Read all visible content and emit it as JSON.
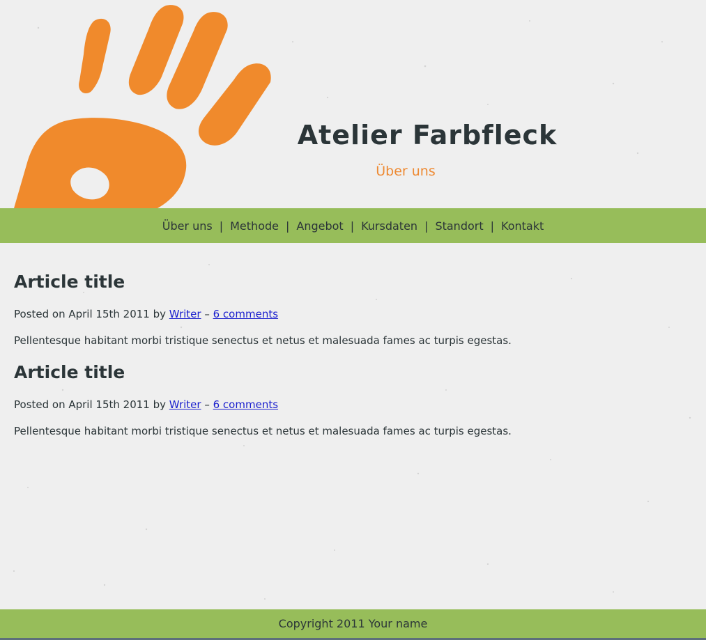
{
  "header": {
    "site_title": "Atelier Farbfleck",
    "subtitle": "Über uns"
  },
  "nav": {
    "items": [
      {
        "label": "Über uns"
      },
      {
        "label": "Methode"
      },
      {
        "label": "Angebot"
      },
      {
        "label": "Kursdaten"
      },
      {
        "label": "Standort"
      },
      {
        "label": "Kontakt"
      }
    ],
    "separator": "|"
  },
  "articles": [
    {
      "title": "Article title",
      "posted_prefix": "Posted on April 15th 2011 by",
      "author": "Writer",
      "dash": "–",
      "comments": "6 comments",
      "body": "Pellentesque habitant morbi tristique senectus et netus et malesuada fames ac turpis egestas."
    },
    {
      "title": "Article title",
      "posted_prefix": "Posted on April 15th 2011 by",
      "author": "Writer",
      "dash": "–",
      "comments": "6 comments",
      "body": "Pellentesque habitant morbi tristique senectus et netus et malesuada fames ac turpis egestas."
    }
  ],
  "footer": {
    "text": "Copyright 2011 Your name"
  },
  "colors": {
    "background": "#efefef",
    "nav_green": "#97bd5a",
    "accent_orange": "#ee8a33",
    "text_dark": "#2b3538",
    "link_blue": "#1a1fce"
  }
}
